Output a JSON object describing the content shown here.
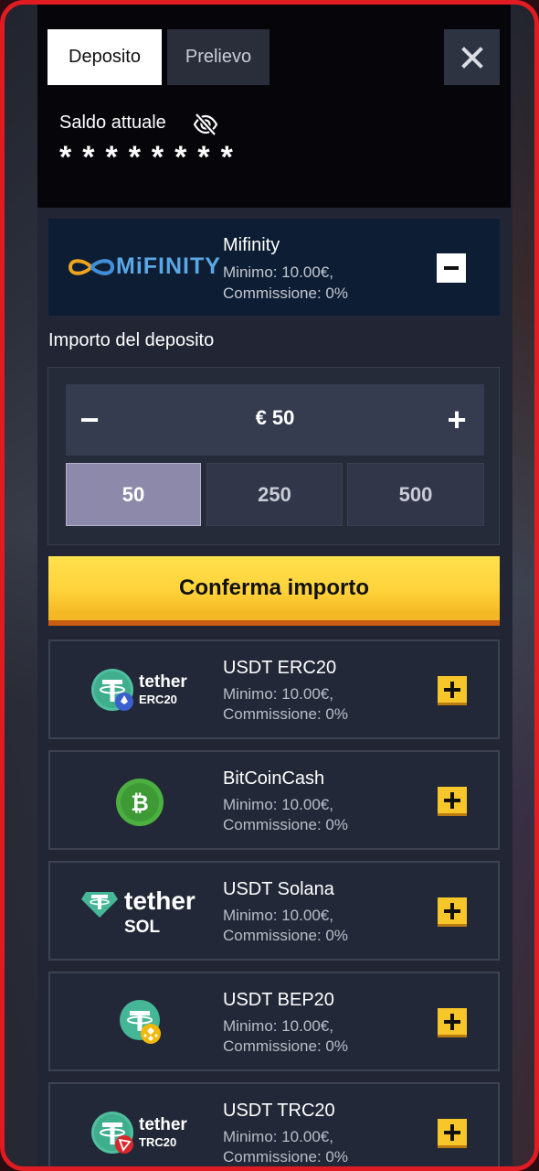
{
  "tabs": {
    "deposit": "Deposito",
    "withdraw": "Prelievo"
  },
  "balance": {
    "label": "Saldo attuale",
    "value": "********"
  },
  "selected_method": {
    "logo_text": "MiFINITY",
    "name": "Mifinity",
    "minimum": "Minimo: 10.00€,",
    "commission": "Commissione: 0%"
  },
  "amount": {
    "label": "Importo del deposito",
    "value": "€ 50",
    "minus": "−",
    "plus": "+",
    "presets": [
      "50",
      "250",
      "500"
    ],
    "selected_preset": "50"
  },
  "confirm_button": "Conferma importo",
  "methods": [
    {
      "name": "USDT ERC20",
      "minimum": "Minimo: 10.00€,",
      "commission": "Commissione: 0%",
      "logo_text": "tether",
      "logo_sub": "ERC20",
      "icon": "tether-erc20-icon"
    },
    {
      "name": "BitCoinCash",
      "minimum": "Minimo: 10.00€,",
      "commission": "Commissione: 0%",
      "icon": "bitcoin-cash-icon"
    },
    {
      "name": "USDT Solana",
      "minimum": "Minimo: 10.00€,",
      "commission": "Commissione: 0%",
      "logo_text": "tether",
      "logo_sub": "SOL",
      "icon": "tether-sol-icon"
    },
    {
      "name": "USDT BEP20",
      "minimum": "Minimo: 10.00€,",
      "commission": "Commissione: 0%",
      "icon": "tether-bep20-icon"
    },
    {
      "name": "USDT TRC20",
      "minimum": "Minimo: 10.00€,",
      "commission": "Commissione: 0%",
      "logo_text": "tether",
      "logo_sub": "TRC20",
      "icon": "tether-trc20-icon"
    }
  ],
  "colors": {
    "frame": "#e01b22",
    "accent_yellow": "#ffd23a",
    "selected_preset": "#8d89aa",
    "mifinity_bg": "#0d1d33"
  }
}
